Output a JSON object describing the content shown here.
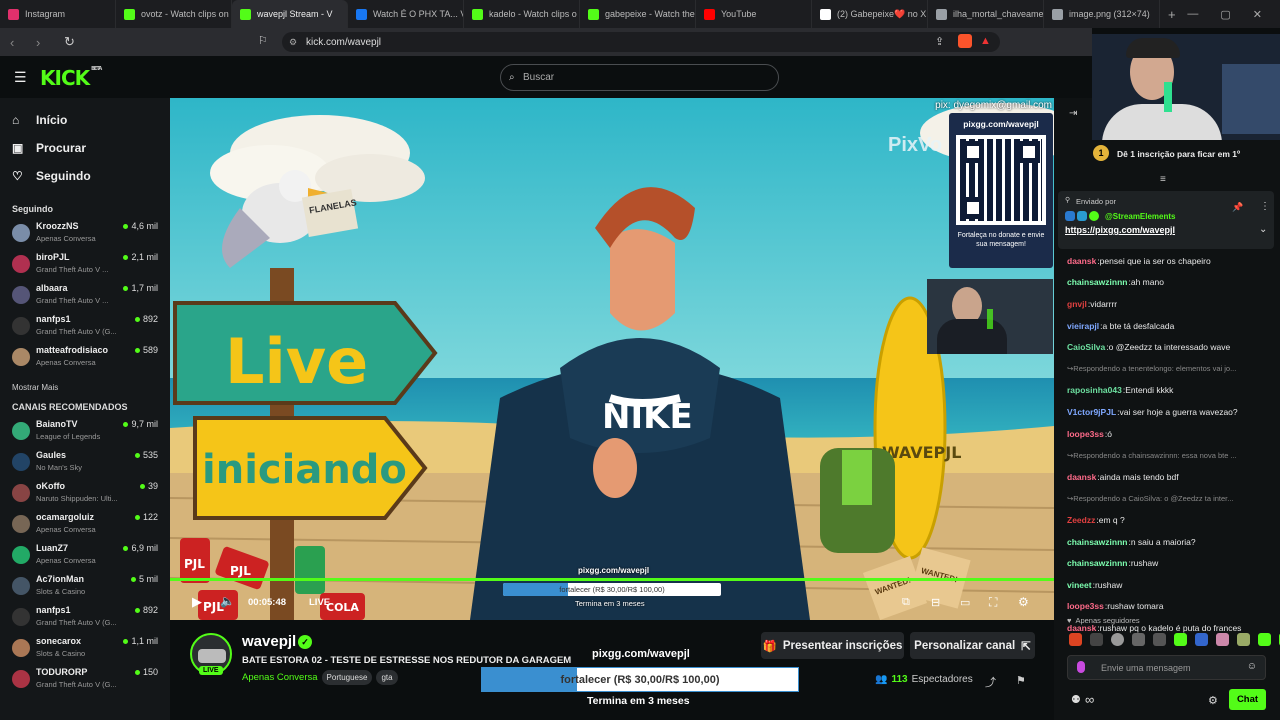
{
  "browser": {
    "tabs": [
      {
        "title": "Instagram",
        "icon": "instagram-icon",
        "color": "#e1306c"
      },
      {
        "title": "ovotz - Watch clips on",
        "icon": "kick-icon",
        "color": "#53fc18"
      },
      {
        "title": "wavepjl Stream - V",
        "icon": "kick-icon",
        "color": "#53fc18",
        "active": true
      },
      {
        "title": "Watch É O PHX TA... Vi",
        "icon": "meta-icon",
        "color": "#1877f2"
      },
      {
        "title": "kadelo - Watch clips o",
        "icon": "kick-icon",
        "color": "#53fc18"
      },
      {
        "title": "gabepeixe - Watch the",
        "icon": "kick-icon",
        "color": "#53fc18"
      },
      {
        "title": "YouTube",
        "icon": "youtube-icon",
        "color": "#ff0000"
      },
      {
        "title": "(2) Gabepeixe❤️ no X",
        "icon": "x-icon",
        "color": "#ffffff"
      },
      {
        "title": "ilha_mortal_chaveame",
        "icon": "globe-icon",
        "color": "#9aa0a6"
      },
      {
        "title": "image.png (312×74)",
        "icon": "globe-icon",
        "color": "#9aa0a6"
      }
    ],
    "url": "kick.com/wavepjl"
  },
  "header": {
    "logo": "KICK",
    "beta": "BETA",
    "search_placeholder": "Buscar"
  },
  "sidebar": {
    "nav": [
      {
        "label": "Início",
        "icon": "home-icon"
      },
      {
        "label": "Procurar",
        "icon": "browse-icon"
      },
      {
        "label": "Seguindo",
        "icon": "heart-icon"
      }
    ],
    "following_title": "Seguindo",
    "following": [
      {
        "name": "KroozzNS",
        "sub": "Apenas Conversa",
        "viewers": "4,6 mil",
        "color": "#7a8da8"
      },
      {
        "name": "biroPJL",
        "sub": "Grand Theft Auto V ...",
        "viewers": "2,1 mil",
        "color": "#b03050"
      },
      {
        "name": "albaara",
        "sub": "Grand Theft Auto V ...",
        "viewers": "1,7 mil",
        "color": "#557"
      },
      {
        "name": "nanfps1",
        "sub": "Grand Theft Auto V (G...",
        "viewers": "892",
        "color": "#333"
      },
      {
        "name": "matteafrodisiaco",
        "sub": "Apenas Conversa",
        "viewers": "589",
        "color": "#a86"
      }
    ],
    "show_more": "Mostrar Mais",
    "recommended_title": "CANAIS RECOMENDADOS",
    "recommended": [
      {
        "name": "BaianoTV",
        "sub": "League of Legends",
        "viewers": "9,7 mil",
        "color": "#3a7"
      },
      {
        "name": "Gaules",
        "sub": "No Man's Sky",
        "viewers": "535",
        "color": "#246"
      },
      {
        "name": "oKoffo",
        "sub": "Naruto Shippuden: Ulti...",
        "viewers": "39",
        "color": "#844"
      },
      {
        "name": "ocamargoluiz",
        "sub": "Apenas Conversa",
        "viewers": "122",
        "color": "#765"
      },
      {
        "name": "LuanZ7",
        "sub": "Apenas Conversa",
        "viewers": "6,9 mil",
        "color": "#2a6"
      },
      {
        "name": "Ac7ionMan",
        "sub": "Slots & Casino",
        "viewers": "5 mil",
        "color": "#456"
      },
      {
        "name": "nanfps1",
        "sub": "Grand Theft Auto V (G...",
        "viewers": "892",
        "color": "#333"
      },
      {
        "name": "sonecarox",
        "sub": "Slots & Casino",
        "viewers": "1,1 mil",
        "color": "#a75"
      },
      {
        "name": "TODURORP",
        "sub": "Grand Theft Auto V (G...",
        "viewers": "150",
        "color": "#a34"
      }
    ]
  },
  "video": {
    "pix": "pix: dyegomix@gmail.com",
    "qr_title": "pixgg.com/wavepjl",
    "qr_caption": "Fortaleça no donate e envie sua mensagem!",
    "pix_partial": "PixVo",
    "sign_live": "Live",
    "sign_iniciando": "iniciando",
    "newspaper": "FLANELAS",
    "board": "WAVEPJL",
    "pixgg_small": "pixgg.com/wavepjl",
    "goal_small": "fortalecer (R$ 30,00/R$ 100,00)",
    "ends_small": "Termina em 3 meses",
    "time": "00:05:48",
    "live_label": "LIVE",
    "wanted": "WANTED!",
    "cans": [
      "PJL",
      "PJL",
      "PJL",
      "COLA"
    ]
  },
  "stream": {
    "name": "wavepjl",
    "title": "BATE ESTORA 02 - TESTE DE ESTRESSE NOS REDUTOR DA GARAGEM",
    "category": "Apenas Conversa",
    "tags": [
      "Portuguese",
      "gta"
    ],
    "live_badge": "LIVE",
    "gift_button": "Presentear inscrições",
    "customize_button": "Personalizar canal",
    "viewers": "113",
    "viewers_label": "Espectadores",
    "goal_site": "pixgg.com/wavepjl",
    "goal_text": "fortalecer (R$ 30,00/R$ 100,00)",
    "goal_progress": 0.3,
    "goal_ends": "Termina em 3 meses"
  },
  "chat": {
    "sub_prompt": "Dê 1 inscrição para ficar em 1º",
    "sub_rank": "1",
    "pinned_by": "Enviado por",
    "pinned_user": "@StreamElements",
    "pinned_link": "https://pixgg.com/wavepjl",
    "messages": [
      {
        "user": "daansk",
        "color": "#ff6b8a",
        "text": "pensei que ia ser os chapeiro"
      },
      {
        "user": "chainsawzinnn",
        "color": "#7dffb0",
        "text": "ah mano"
      },
      {
        "user": "gnvjl",
        "color": "#e04040",
        "text": "vidarrrr"
      },
      {
        "user": "vieirapjl",
        "color": "#7fa8ff",
        "text": "a bte tá desfalcada"
      },
      {
        "user": "CaioSilva",
        "color": "#6de0a0",
        "text": "o @Zeedzz ta interessado wave"
      },
      {
        "reply": "Respondendo a tenentelongo: elementos vai jo..."
      },
      {
        "user": "raposinha043",
        "color": "#6de0a0",
        "text": "Entendi kkkk"
      },
      {
        "user": "V1ctor9jPJL",
        "color": "#7fa8ff",
        "text": "vai ser hoje a guerra wavezao?"
      },
      {
        "user": "loope3ss",
        "color": "#ff6b8a",
        "text": "ó"
      },
      {
        "reply": "Respondendo a chainsawzinnn: essa nova bte ..."
      },
      {
        "user": "daansk",
        "color": "#ff6b8a",
        "text": "ainda mais tendo bdf"
      },
      {
        "reply": "Respondendo a CaioSilva: o @Zeedzz ta inter..."
      },
      {
        "user": "Zeedzz",
        "color": "#e04040",
        "text": "em q ?"
      },
      {
        "user": "chainsawzinnn",
        "color": "#7dffb0",
        "text": "n saiu a maioria?"
      },
      {
        "user": "chainsawzinnn",
        "color": "#7dffb0",
        "text": "rushaw"
      },
      {
        "user": "vineet",
        "color": "#7dffb0",
        "text": "rushaw"
      },
      {
        "user": "loope3ss",
        "color": "#ff6b8a",
        "text": "rushaw tomara"
      },
      {
        "user": "daansk",
        "color": "#ff6b8a",
        "text": "rushaw pq o kadelo é puta do frances"
      }
    ],
    "followers_only": "Apenas seguidores",
    "input_placeholder": "Envie uma mensagem",
    "chat_button": "Chat"
  }
}
